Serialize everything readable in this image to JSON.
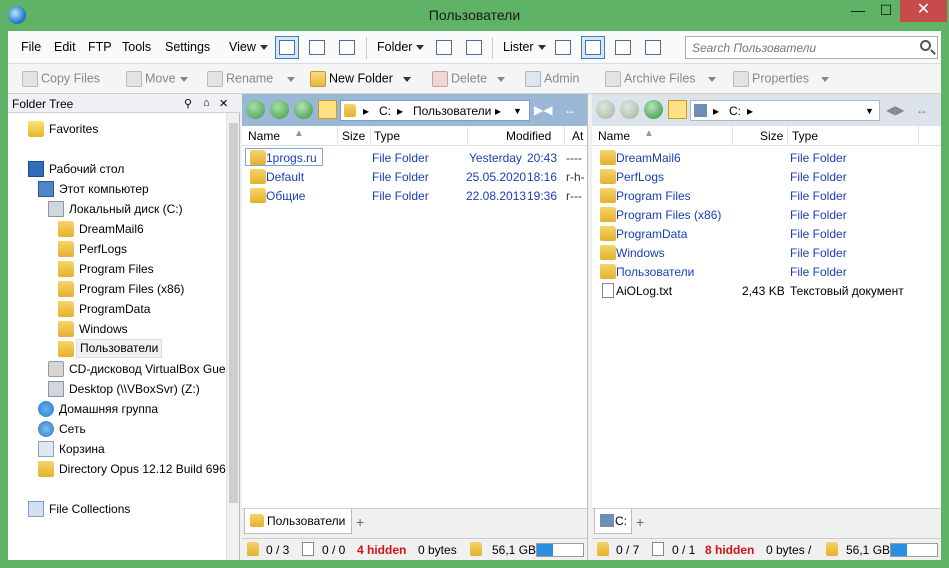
{
  "window": {
    "title": "Пользователи",
    "minimize": "—",
    "maximize": "☐",
    "close": "✕"
  },
  "menu": {
    "file": "File",
    "edit": "Edit",
    "ftp": "FTP",
    "tools": "Tools",
    "settings": "Settings",
    "view": "View",
    "folder": "Folder",
    "lister": "Lister"
  },
  "search": {
    "placeholder": "Search Пользователи"
  },
  "toolbar": {
    "copy": "Copy Files",
    "move": "Move",
    "rename": "Rename",
    "new_folder": "New Folder",
    "delete": "Delete",
    "admin": "Admin",
    "archive": "Archive Files",
    "properties": "Properties"
  },
  "tree": {
    "header": "Folder Tree",
    "items": [
      {
        "label": "Favorites"
      },
      {
        "label": "Рабочий стол"
      },
      {
        "label": "Этот компьютер"
      },
      {
        "label": "Локальный диск (C:)"
      },
      {
        "label": "DreamMail6"
      },
      {
        "label": "PerfLogs"
      },
      {
        "label": "Program Files"
      },
      {
        "label": "Program Files (x86)"
      },
      {
        "label": "ProgramData"
      },
      {
        "label": "Windows"
      },
      {
        "label": "Пользователи"
      },
      {
        "label": "CD-дисковод VirtualBox Gue"
      },
      {
        "label": "Desktop (\\\\VBoxSvr) (Z:)"
      },
      {
        "label": "Домашняя группа"
      },
      {
        "label": "Сеть"
      },
      {
        "label": "Корзина"
      },
      {
        "label": "Directory Opus 12.12 Build 696"
      },
      {
        "label": "File Collections"
      }
    ]
  },
  "left_pane": {
    "path": "C:",
    "path_sub": "Пользователи",
    "columns": {
      "name": "Name",
      "size": "Size",
      "type": "Type",
      "modified": "Modified",
      "attr": "At"
    },
    "rows": [
      {
        "name": "1progs.ru",
        "size": "",
        "type": "File Folder",
        "date": "Yesterday",
        "time": "20:43",
        "attr": "----"
      },
      {
        "name": "Default",
        "size": "",
        "type": "File Folder",
        "date": "25.05.2020",
        "time": "18:16",
        "attr": "r-h-"
      },
      {
        "name": "Общие",
        "size": "",
        "type": "File Folder",
        "date": "22.08.2013",
        "time": "19:36",
        "attr": "r---"
      }
    ],
    "tab": "Пользователи",
    "status": {
      "folders": "0 / 3",
      "files": "0 / 0",
      "hidden": "4 hidden",
      "bytes": "0 bytes",
      "free": "56,1 GB",
      "usage": 0.35
    }
  },
  "right_pane": {
    "path": "C:",
    "columns": {
      "name": "Name",
      "size": "Size",
      "type": "Type"
    },
    "rows": [
      {
        "name": "DreamMail6",
        "size": "",
        "type": "File Folder"
      },
      {
        "name": "PerfLogs",
        "size": "",
        "type": "File Folder"
      },
      {
        "name": "Program Files",
        "size": "",
        "type": "File Folder"
      },
      {
        "name": "Program Files (x86)",
        "size": "",
        "type": "File Folder"
      },
      {
        "name": "ProgramData",
        "size": "",
        "type": "File Folder"
      },
      {
        "name": "Windows",
        "size": "",
        "type": "File Folder"
      },
      {
        "name": "Пользователи",
        "size": "",
        "type": "File Folder"
      },
      {
        "name": "AiOLog.txt",
        "size": "2,43 KB",
        "type": "Текстовый документ"
      }
    ],
    "tab": "C:",
    "status": {
      "folders": "0 / 7",
      "files": "0 / 1",
      "hidden": "8 hidden",
      "bytes": "0 bytes /",
      "free": "56,1 GB",
      "usage": 0.35
    }
  },
  "colors": {
    "title_bg": "#5fb366",
    "accent": "#3c7fb1",
    "link": "#1a3eb5",
    "hidden": "#d01515"
  }
}
